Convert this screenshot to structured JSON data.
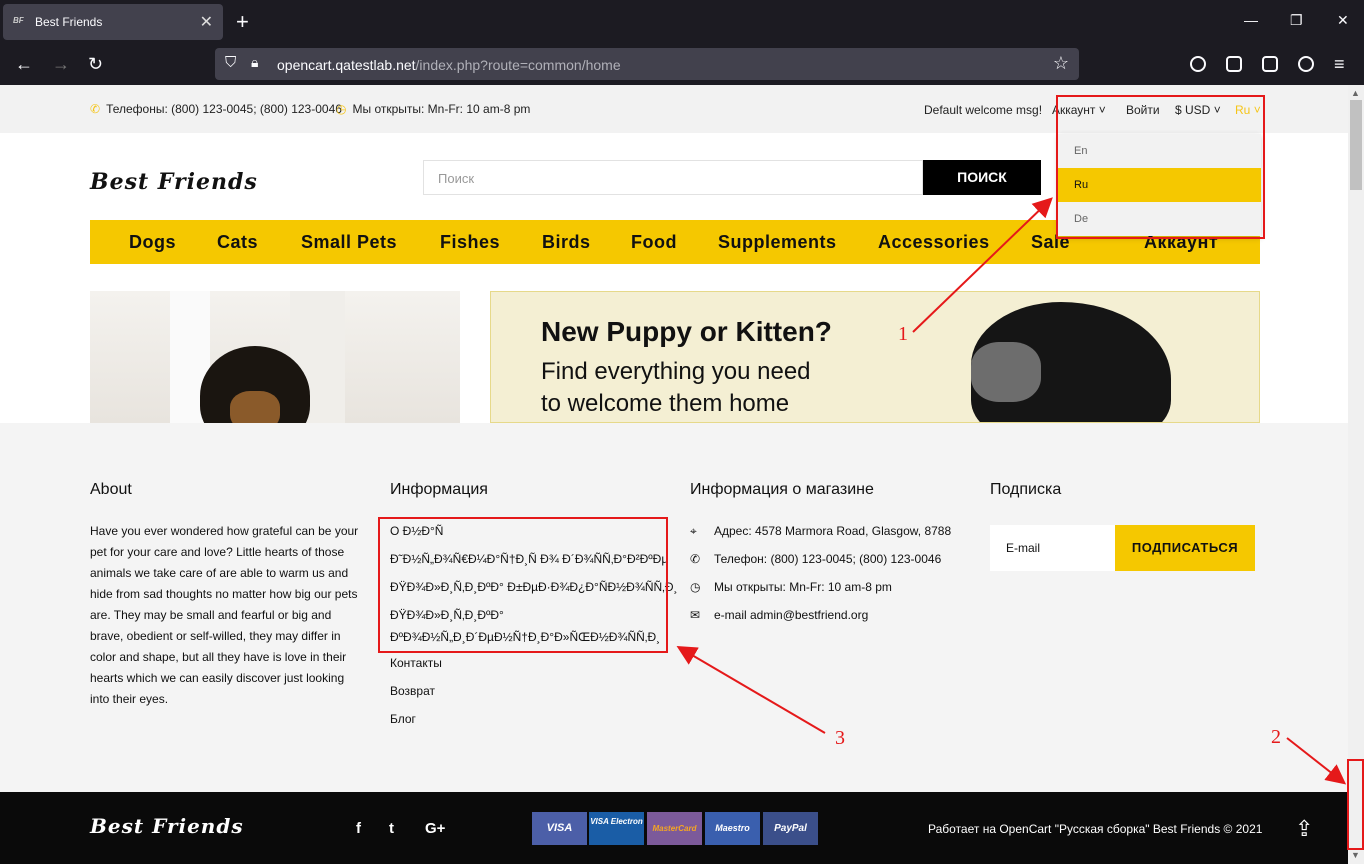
{
  "browser": {
    "tab_title": "Best Friends",
    "tab_favicon": "BF",
    "url_host": "opencart.qatestlab.net",
    "url_path": "/index.php?route=common/home"
  },
  "topbar": {
    "phones": "Телефоны: (800) 123-0045; (800) 123-0046",
    "hours": "Мы открыты: Mn-Fr: 10 am-8 pm",
    "welcome": "Default welcome msg!",
    "account": "Аккаунт",
    "login": "Войти",
    "currency": "$ USD",
    "language": "Ru"
  },
  "language_dropdown": [
    "En",
    "Ru",
    "De"
  ],
  "header": {
    "logo": "Best Friends",
    "search_placeholder": "Поиск",
    "search_button": "ПОИСК"
  },
  "menu": [
    "Dogs",
    "Cats",
    "Small Pets",
    "Fishes",
    "Birds",
    "Food",
    "Supplements",
    "Accessories",
    "Sale",
    "Аккаунт"
  ],
  "banner": {
    "headline": "New Puppy or Kitten?",
    "line1": "Find everything you need",
    "line2": "to welcome them home"
  },
  "footer": {
    "about_title": "About",
    "about_text": "Have you ever wondered how grateful can be your pet for your care and love? Little hearts of those animals we take care of are able to warm us and hide from sad thoughts no matter how big our pets are. They may be small and fearful or big and brave, obedient or self-willed, they may differ in color and shape, but all they have is love in their hearts which we can easily discover just looking into their eyes.",
    "info_title": "Информация",
    "info_links": [
      "О Ð½Ð°Ñ",
      "Ð˜Ð½Ñ„Ð¾Ñ€Ð¼Ð°Ñ†Ð¸Ñ Ð¾ Ð´Ð¾ÑÑ‚Ð°Ð²ÐºÐµ",
      "ÐŸÐ¾Ð»Ð¸Ñ‚Ð¸ÐºÐ° Ð±ÐµÐ·Ð¾Ð¿Ð°ÑÐ½Ð¾ÑÑ‚Ð¸",
      "ÐŸÐ¾Ð»Ð¸Ñ‚Ð¸ÐºÐ°",
      "ÐºÐ¾Ð½Ñ„Ð¸Ð´ÐµÐ½Ñ†Ð¸Ð°Ð»ÑŒÐ½Ð¾ÑÑ‚Ð¸",
      "Контакты",
      "Возврат",
      "Блог"
    ],
    "store_title": "Информация о магазине",
    "store_address": "Адрес: 4578 Marmora Road, Glasgow, 8788",
    "store_phone": "Телефон: (800) 123-0045; (800) 123-0046",
    "store_hours": "Мы открыты: Mn-Fr: 10 am-8 pm",
    "store_email": "e-mail admin@bestfriend.org",
    "subscribe_title": "Подписка",
    "email_placeholder": "E-mail",
    "subscribe_button": "ПОДПИСАТЬСЯ"
  },
  "bottom": {
    "logo": "Best Friends",
    "social": [
      "f",
      "t",
      "G+"
    ],
    "payments": [
      "VISA",
      "VISA Electron",
      "MasterCard",
      "Maestro",
      "PayPal"
    ],
    "powered": "Работает на OpenCart \"Русская сборка\" Best Friends © 2021"
  },
  "annotations": [
    "1",
    "2",
    "3"
  ]
}
